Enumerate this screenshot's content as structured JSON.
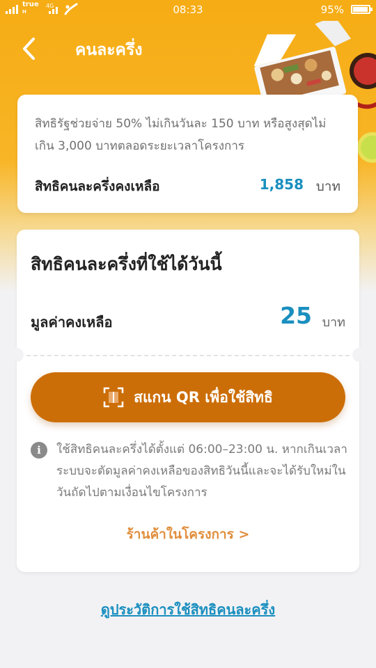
{
  "status_bar": {
    "carrier": "true",
    "carrier_sub": "H",
    "network": "4G",
    "time": "08:33",
    "battery": "95%"
  },
  "header": {
    "title": "คนละครึ่ง",
    "back_icon": "chevron-left-icon"
  },
  "summary": {
    "description": "สิทธิรัฐช่วยจ่าย 50% ไม่เกินวันละ 150 บาท หรือสูงสุดไม่เกิน 3,000 บาทตลอดระยะเวลาโครงการ",
    "remaining_label": "สิทธิคนละครึ่งคงเหลือ",
    "remaining_value": "1,858",
    "remaining_unit": "บาท"
  },
  "today": {
    "title": "สิทธิคนละครึ่งที่ใช้ได้วันนี้",
    "remaining_label": "มูลค่าคงเหลือ",
    "remaining_value": "25",
    "remaining_unit": "บาท",
    "scan_button": "สแกน QR เพื่อใช้สิทธิ",
    "info_text": "ใช้สิทธิคนละครึ่งได้ตั้งแต่ 06:00–23:00 น. หากเกินเวลา ระบบจะตัดมูลค่าคงเหลือของสิทธิวันนี้และจะได้รับใหม่ในวันถัดไปตามเงื่อนไขโครงการ",
    "shop_link": "ร้านค้าในโครงการ >"
  },
  "history_link": "ดูประวัติการใช้สิทธิคนละครึ่ง",
  "colors": {
    "header_bg": "#f6ac14",
    "accent_blue": "#1a8fbf",
    "button_orange": "#cc6e08",
    "link_orange": "#e08e3c"
  }
}
